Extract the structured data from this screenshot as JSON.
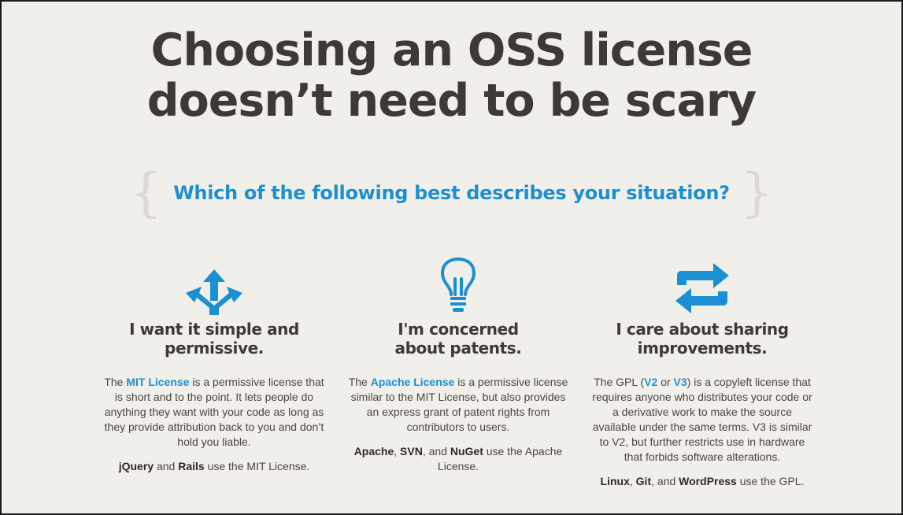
{
  "title": {
    "line1": "Choosing an OSS license",
    "line2": "doesn’t need to be scary"
  },
  "question": {
    "brace_left": "{",
    "text": "Which of the following best describes your situation?",
    "brace_right": "}"
  },
  "colors": {
    "accent": "#1b8fd2",
    "text_dark": "#3f3935",
    "background": "#f1efea"
  },
  "options": [
    {
      "icon": "arrows-split-icon",
      "heading_line1": "I want it simple and",
      "heading_line2": "permissive.",
      "desc_pre": "The ",
      "desc_link": "MIT License",
      "desc_post": " is a permissive license that is short and to the point. It lets people do anything they want with your code as long as they provide attribution back to you and don’t hold you liable.",
      "users": [
        {
          "name": "jQuery",
          "sep": " and "
        },
        {
          "name": "Rails",
          "sep": ""
        }
      ],
      "users_suffix": " use the MIT License."
    },
    {
      "icon": "lightbulb-icon",
      "heading_line1": "I'm concerned",
      "heading_line2": "about patents.",
      "desc_pre": "The ",
      "desc_link": "Apache License",
      "desc_post": " is a permissive license similar to the MIT License, but also provides an express grant of patent rights from contributors to users.",
      "users": [
        {
          "name": "Apache",
          "sep": ", "
        },
        {
          "name": "SVN",
          "sep": ", and "
        },
        {
          "name": "NuGet",
          "sep": ""
        }
      ],
      "users_suffix": " use the Apache License."
    },
    {
      "icon": "repeat-icon",
      "heading_line1": "I care about sharing",
      "heading_line2": "improvements.",
      "desc_pre": "The GPL (",
      "desc_link": "V2",
      "desc_mid": " or ",
      "desc_link2": "V3",
      "desc_post": ") is a copyleft license that requires anyone who distributes your code or a derivative work to make the source available under the same terms. V3 is similar to V2, but further restricts use in hardware that forbids software alterations.",
      "users": [
        {
          "name": "Linux",
          "sep": ", "
        },
        {
          "name": "Git",
          "sep": ", and "
        },
        {
          "name": "WordPress",
          "sep": ""
        }
      ],
      "users_suffix": " use the GPL."
    }
  ]
}
